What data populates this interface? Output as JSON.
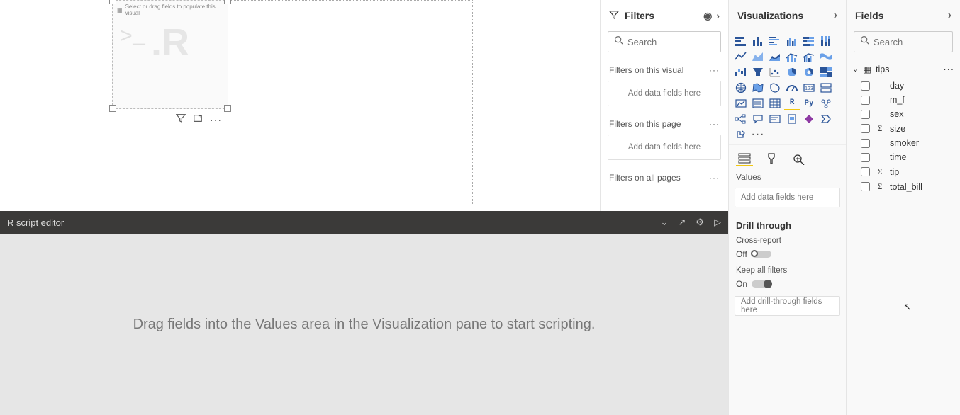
{
  "canvas": {
    "r_visual_hint": "Select or drag fields to populate this visual",
    "r_watermark": ".R",
    "prompt": ">_"
  },
  "filters": {
    "title": "Filters",
    "search_placeholder": "Search",
    "sections": {
      "visual": {
        "title": "Filters on this visual",
        "drop": "Add data fields here"
      },
      "page": {
        "title": "Filters on this page",
        "drop": "Add data fields here"
      },
      "all": {
        "title": "Filters on all pages"
      }
    }
  },
  "viz": {
    "title": "Visualizations",
    "r_label": "R",
    "py_label": "Py",
    "values_label": "Values",
    "values_drop": "Add data fields here",
    "drill_title": "Drill through",
    "cross_report_label": "Cross-report",
    "cross_report_state": "Off",
    "keep_filters_label": "Keep all filters",
    "keep_filters_state": "On",
    "drill_drop": "Add drill-through fields here",
    "more": "···"
  },
  "fields": {
    "title": "Fields",
    "search_placeholder": "Search",
    "table_name": "tips",
    "items": [
      {
        "name": "day",
        "numeric": false
      },
      {
        "name": "m_f",
        "numeric": false
      },
      {
        "name": "sex",
        "numeric": false
      },
      {
        "name": "size",
        "numeric": true
      },
      {
        "name": "smoker",
        "numeric": false
      },
      {
        "name": "time",
        "numeric": false
      },
      {
        "name": "tip",
        "numeric": true
      },
      {
        "name": "total_bill",
        "numeric": true
      }
    ]
  },
  "r_editor": {
    "title": "R script editor",
    "body_msg": "Drag fields into the Values area in the Visualization pane to start scripting."
  }
}
